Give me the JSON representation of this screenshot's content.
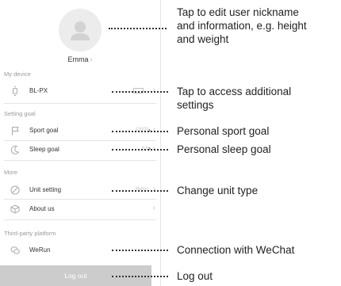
{
  "profile": {
    "name": "Emma",
    "chevron": "›"
  },
  "sections": {
    "device": "My device",
    "goal": "Setting goal",
    "more": "More",
    "third_party": "Third-party platform"
  },
  "rows": {
    "device": {
      "label": "BL-PX",
      "icon": "watch-icon"
    },
    "sport": {
      "label": "Sport goal",
      "value": "10000",
      "icon": "flag-icon"
    },
    "sleep": {
      "label": "Sleep goal",
      "value": "8 h",
      "icon": "moon-icon"
    },
    "unit": {
      "label": "Unit setting",
      "value": "Metric",
      "icon": "ruler-icon"
    },
    "about": {
      "label": "About us",
      "icon": "cube-icon"
    },
    "wechat": {
      "label": "WeRun",
      "icon": "wechat-icon"
    }
  },
  "logout_label": "Log out",
  "chevron": "›",
  "annotations": {
    "profile_line1": "Tap to edit user nickname",
    "profile_line2": "and information, e.g. height",
    "profile_line3": "and weight",
    "device_line1": "Tap to access additional",
    "device_line2": "settings",
    "sport": "Personal sport goal",
    "sleep": "Personal sleep goal",
    "unit": "Change unit type",
    "wechat": "Connection with WeChat",
    "logout": "Log out"
  },
  "colors": {
    "accent_gray": "#cccccc",
    "text": "#333333",
    "muted": "#9a9a9a"
  }
}
